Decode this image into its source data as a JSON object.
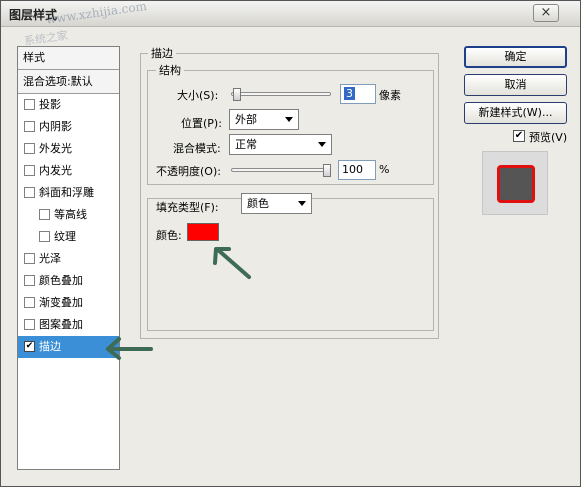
{
  "window": {
    "title": "图层样式",
    "close_glyph": "×",
    "watermark_a": "www.xzhijia.com",
    "watermark_b": "系统之家"
  },
  "styles_list": {
    "header": "样式",
    "blend_options": "混合选项:默认",
    "items": [
      {
        "label": "投影",
        "checked": false
      },
      {
        "label": "内阴影",
        "checked": false
      },
      {
        "label": "外发光",
        "checked": false
      },
      {
        "label": "内发光",
        "checked": false
      },
      {
        "label": "斜面和浮雕",
        "checked": false
      },
      {
        "label": "等高线",
        "checked": false
      },
      {
        "label": "纹理",
        "checked": false
      },
      {
        "label": "光泽",
        "checked": false
      },
      {
        "label": "颜色叠加",
        "checked": false
      },
      {
        "label": "渐变叠加",
        "checked": false
      },
      {
        "label": "图案叠加",
        "checked": false
      },
      {
        "label": "描边",
        "checked": true
      }
    ],
    "check_glyph": "✔"
  },
  "stroke": {
    "section_title": "描边",
    "structure_title": "结构",
    "size_label": "大小(S):",
    "size_value": "3",
    "size_unit": "像素",
    "size_fraction": 0.02,
    "position_label": "位置(P):",
    "position_value": "外部",
    "blend_mode_label": "混合模式:",
    "blend_mode_value": "正常",
    "opacity_label": "不透明度(O):",
    "opacity_value": "100",
    "opacity_unit": "%",
    "opacity_fraction": 1.0,
    "fill_type_label": "填充类型(F):",
    "fill_type_value": "颜色",
    "color_label": "颜色:",
    "color_hex": "#ff0000"
  },
  "buttons": {
    "ok": "确定",
    "cancel": "取消",
    "new_style": "新建样式(W)...",
    "preview_label": "预览(V)",
    "preview_checked": true
  },
  "colors": {
    "selection": "#3b8fd6",
    "arrow": "#3e6b55",
    "preview_stroke": "#e01010"
  }
}
